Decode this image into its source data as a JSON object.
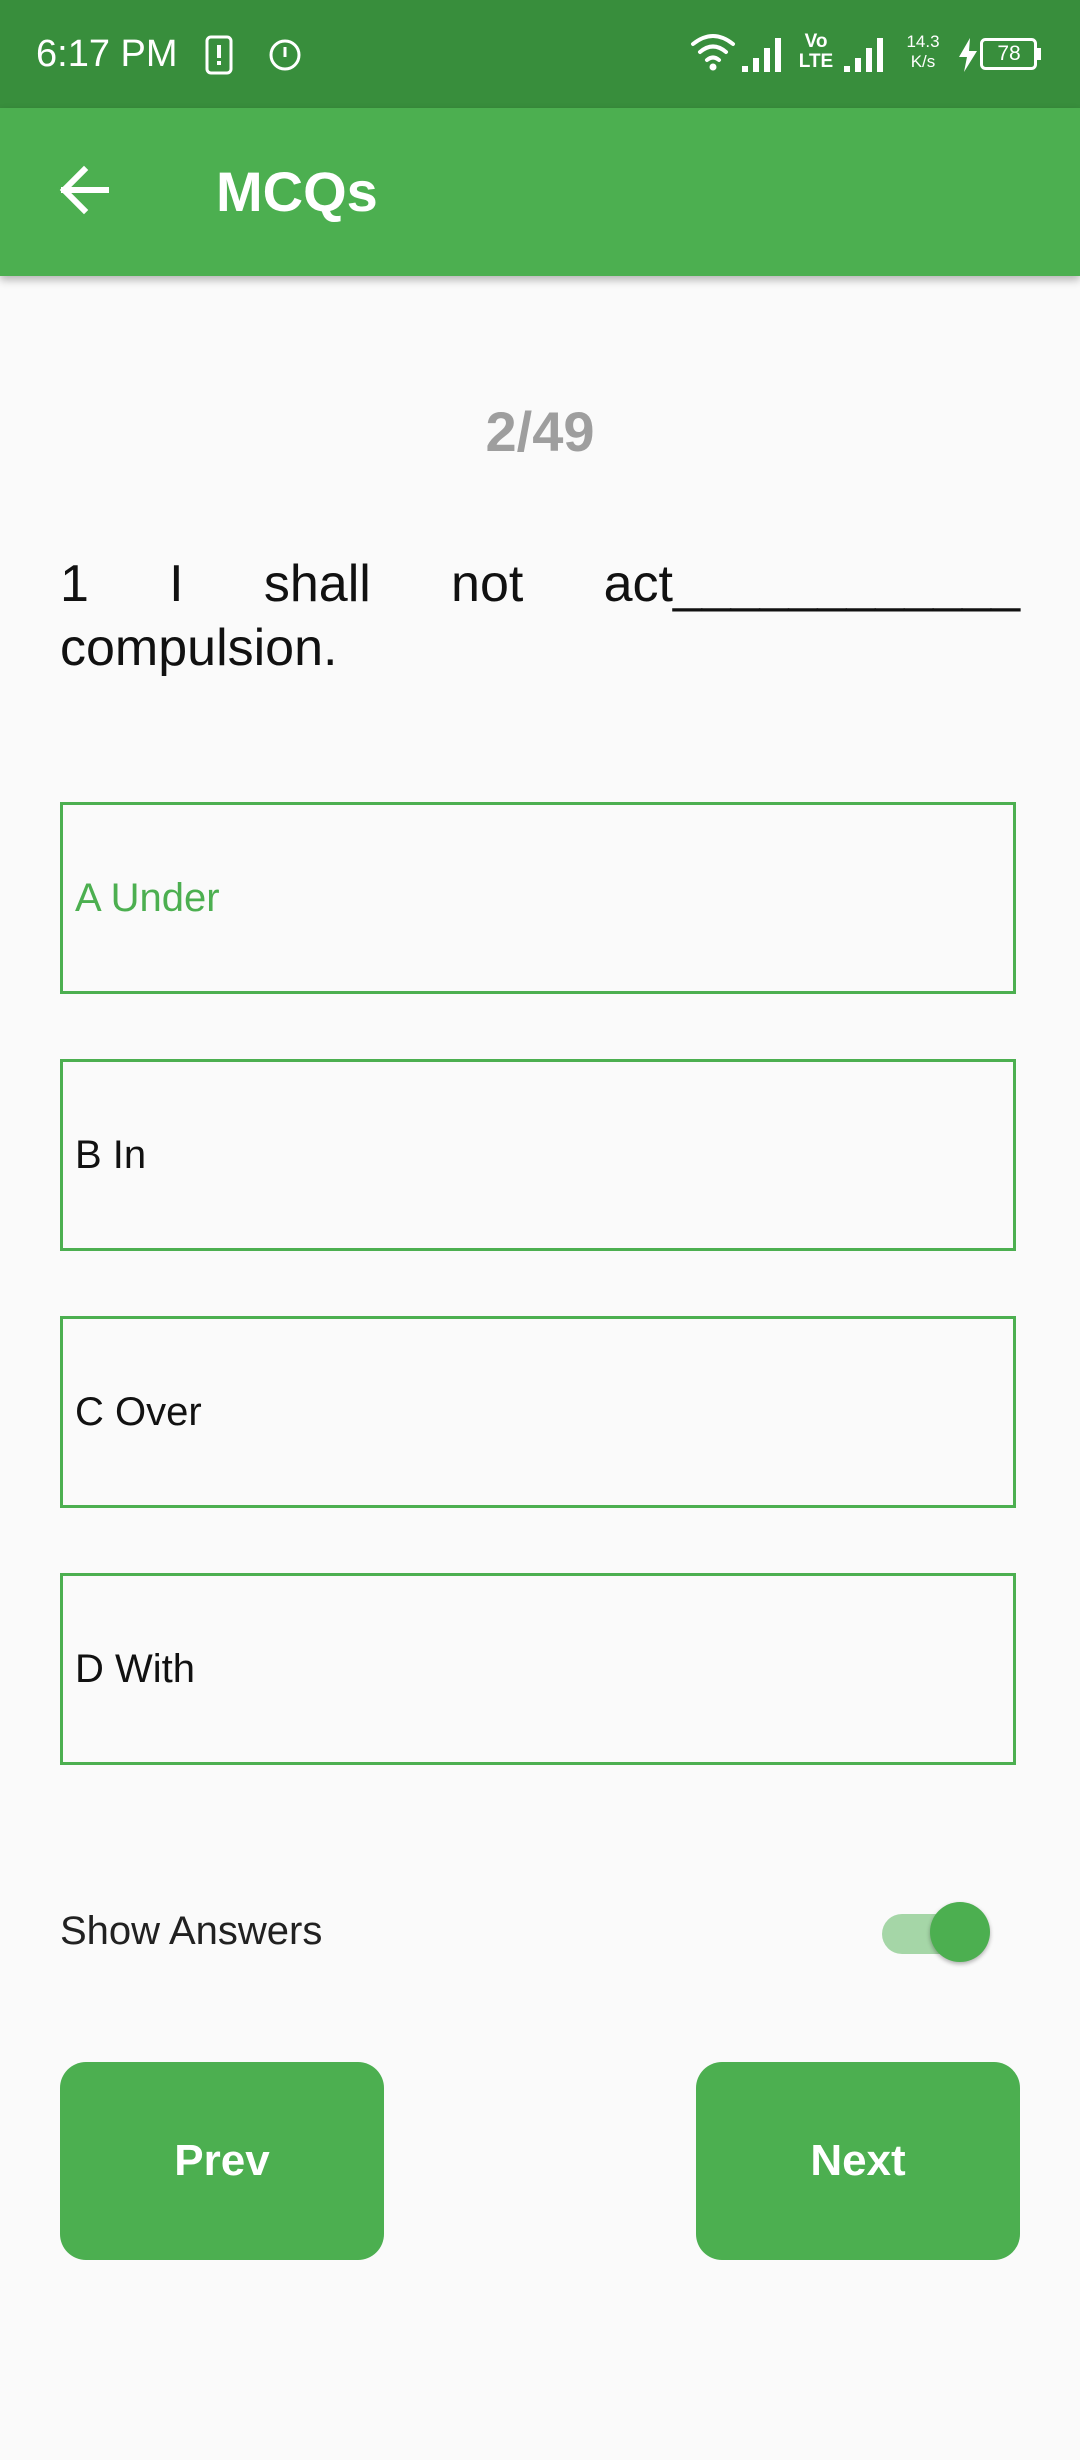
{
  "status_bar": {
    "time": "6:17 PM",
    "net_speed_value": "14.3",
    "net_speed_unit": "K/s",
    "battery": "78",
    "volte_top": "Vo",
    "volte_bottom": "LTE"
  },
  "app_bar": {
    "title": "MCQs",
    "back_icon": "arrow-back-icon"
  },
  "counter": "2/49",
  "question": "1 I shall not act____________ compulsion.",
  "options": [
    {
      "label": "A Under",
      "selected": true
    },
    {
      "label": "B In",
      "selected": false
    },
    {
      "label": "C Over",
      "selected": false
    },
    {
      "label": "D With",
      "selected": false
    }
  ],
  "show_answers": {
    "label": "Show Answers",
    "enabled": true
  },
  "buttons": {
    "prev": "Prev",
    "next": "Next"
  },
  "colors": {
    "status_bar": "#388e3c",
    "primary": "#4caf50",
    "counter_text": "#9e9e9e",
    "background": "#fafafa"
  }
}
